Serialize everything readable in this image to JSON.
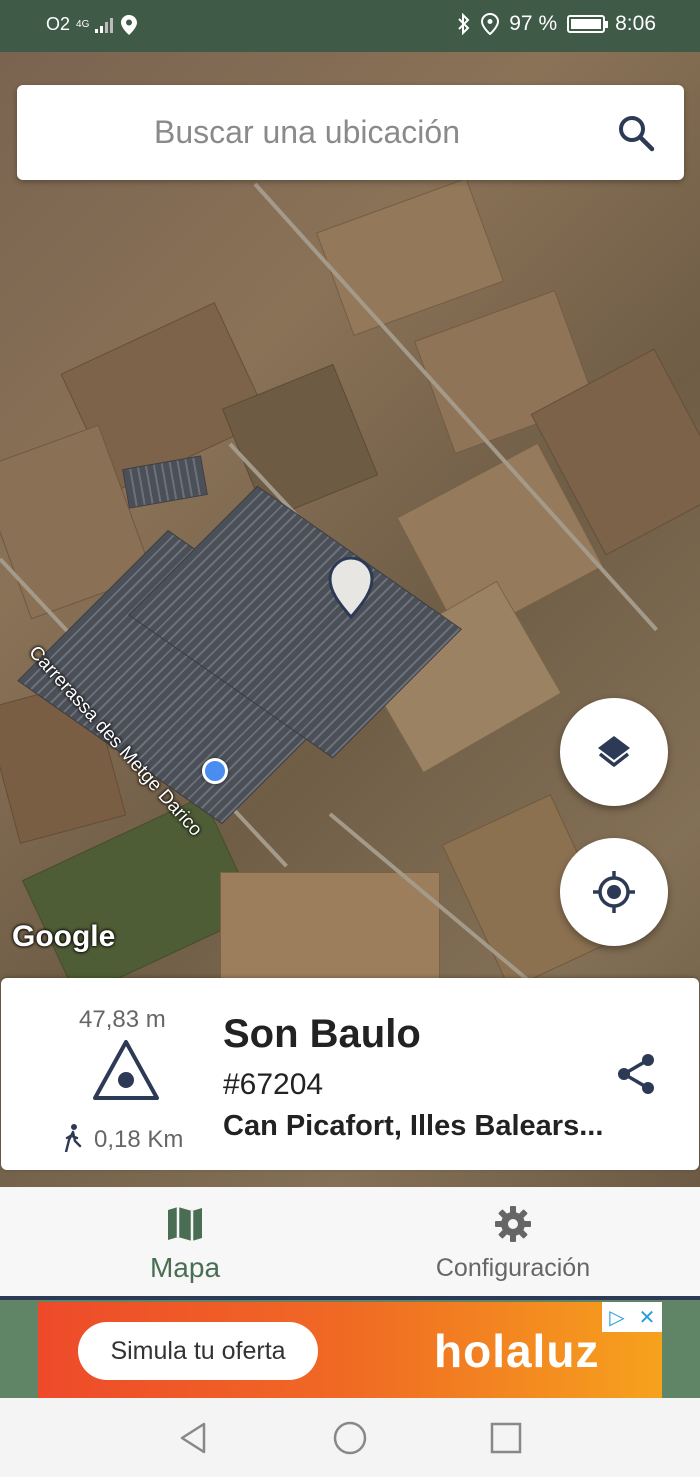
{
  "status_bar": {
    "carrier": "O2",
    "network": "4G",
    "battery": "97 %",
    "time": "8:06"
  },
  "search": {
    "placeholder": "Buscar una ubicación",
    "value": ""
  },
  "map": {
    "attribution": "Google",
    "street_label": "Carrerassa des Metge Darico"
  },
  "info_card": {
    "elevation": "47,83 m",
    "distance": "0,18 Km",
    "title": "Son Baulo",
    "id": "#67204",
    "location": "Can Picafort, Illes Balears..."
  },
  "bottom_nav": {
    "items": [
      {
        "label": "Mapa",
        "icon": "map-icon",
        "active": true
      },
      {
        "label": "Configuración",
        "icon": "gear-icon",
        "active": false
      }
    ]
  },
  "ad": {
    "button_label": "Simula tu oferta",
    "brand": "holaluz"
  },
  "colors": {
    "status_bar": "#3f5a47",
    "accent_green": "#4a6e54",
    "icon_navy": "#2d3a55",
    "user_dot": "#4a8df0"
  }
}
